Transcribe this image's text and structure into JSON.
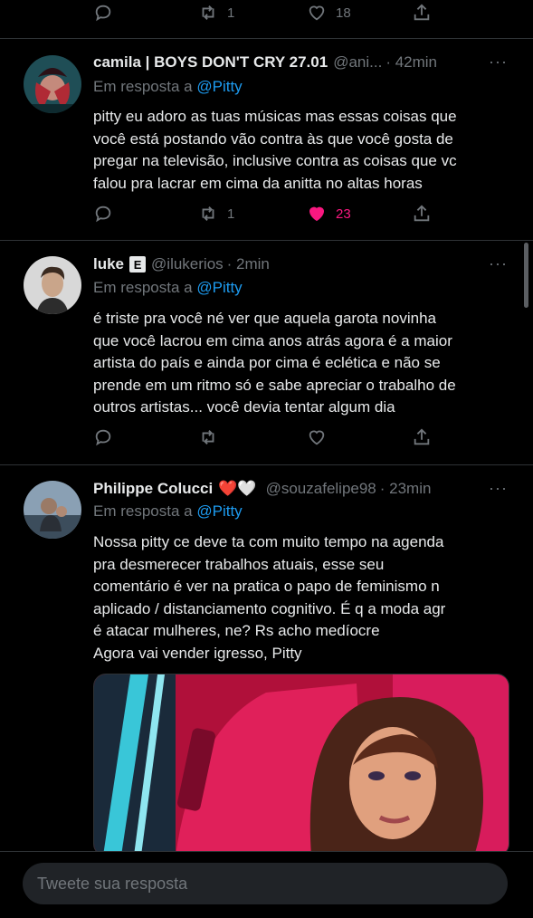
{
  "top_actions": {
    "retweets": "1",
    "likes": "18"
  },
  "tweets": [
    {
      "name": "camila | BOYS DON'T CRY 27.01",
      "handle": "@ani...",
      "time": "· 42min",
      "reply_prefix": "Em resposta a",
      "reply_to": "@Pitty",
      "text": "pitty eu adoro as tuas músicas mas essas coisas que\nvocê está postando vão contra às que você gosta de\npregar na televisão, inclusive contra as coisas que vc\nfalou pra lacrar em cima da anitta no altas horas",
      "retweets": "1",
      "likes": "23",
      "liked": true
    },
    {
      "name": "luke",
      "badge": "E",
      "handle": "@ilukerios",
      "time": "· 2min",
      "reply_prefix": "Em resposta a",
      "reply_to": "@Pitty",
      "text": "é triste pra você né ver que aquela garota novinha\nque você lacrou em cima anos atrás agora é a maior\nartista do país e ainda por cima é eclética e não se\nprende em um ritmo só e sabe apreciar o trabalho de\noutros artistas... você devia tentar algum dia"
    },
    {
      "name": "Philippe Colucci",
      "emoji": "❤️🤍",
      "handle": "@souzafelipe98",
      "time": "· 23min",
      "reply_prefix": "Em resposta a",
      "reply_to": "@Pitty",
      "text": "Nossa pitty ce deve ta com muito tempo na agenda\npra desmerecer trabalhos atuais, esse seu\ncomentário é ver na pratica o papo de feminismo n\naplicado / distanciamento cognitivo. É q a moda agr\né atacar mulheres, ne? Rs acho medíocre\nAgora vai vender igresso, Pitty"
    }
  ],
  "more_icon": "···",
  "composer": {
    "placeholder": "Tweete sua resposta"
  },
  "colors": {
    "accent": "#1d9bf0",
    "like": "#f91880",
    "muted": "#71767b",
    "background": "#000000"
  }
}
